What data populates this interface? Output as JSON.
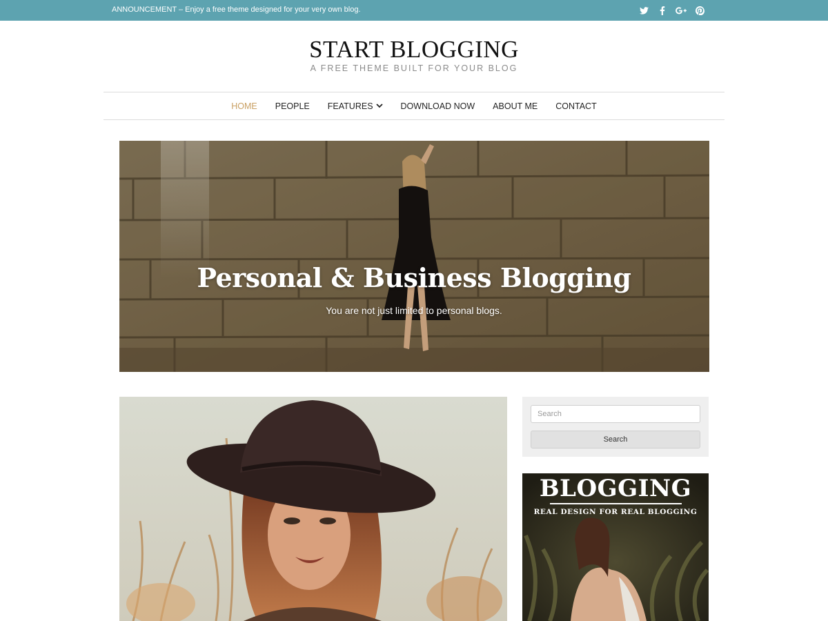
{
  "topbar": {
    "announcement": "ANNOUNCEMENT – Enjoy a free theme designed for your very own blog.",
    "background_color": "#5da3b0",
    "social_icons": [
      "twitter-icon",
      "facebook-icon",
      "google-plus-icon",
      "pinterest-icon"
    ]
  },
  "header": {
    "site_title": "START BLOGGING",
    "tagline": "A FREE THEME BUILT FOR YOUR BLOG"
  },
  "nav": {
    "active_color": "#c9a063",
    "items": [
      {
        "label": "HOME",
        "active": true
      },
      {
        "label": "PEOPLE"
      },
      {
        "label": "FEATURES",
        "has_dropdown": true
      },
      {
        "label": "DOWNLOAD NOW"
      },
      {
        "label": "ABOUT ME"
      },
      {
        "label": "CONTACT"
      }
    ]
  },
  "hero": {
    "title": "Personal & Business Blogging",
    "subtitle": "You are not just limited to personal blogs."
  },
  "sidebar": {
    "search": {
      "placeholder": "Search",
      "value": "",
      "button_label": "Search"
    },
    "banner": {
      "title": "BLOGGING",
      "subtitle": "REAL DESIGN FOR REAL BLOGGING"
    }
  }
}
